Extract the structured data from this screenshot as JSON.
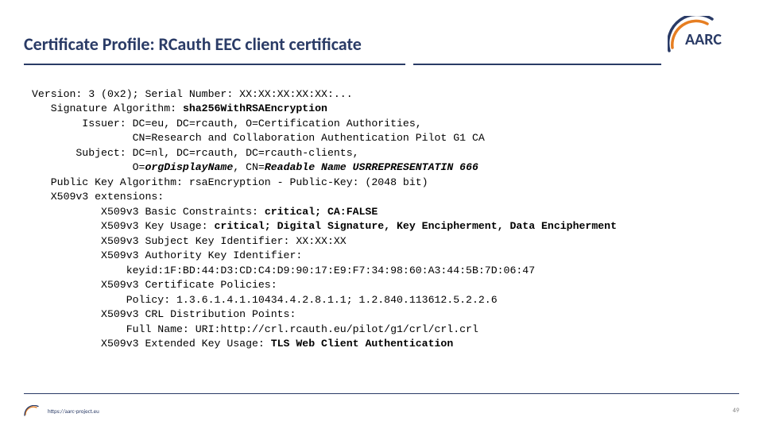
{
  "title": "Certificate Profile: RCauth EEC client certificate",
  "logo_text": "AARC",
  "footer_url": "https://aarc-project.eu",
  "page_number": "49",
  "cert": {
    "l01a": "Version: 3 (0x2); Serial Number: ",
    "l01b": "XX:XX:XX:XX:XX:...",
    "l02a": "   Signature Algorithm: ",
    "l02b": "sha256WithRSAEncryption",
    "l03": "        Issuer: DC=eu, DC=rcauth, O=Certification Authorities,",
    "l04": "                CN=Research and Collaboration Authentication Pilot G1 CA",
    "l05": "       Subject: DC=nl, DC=rcauth, DC=rcauth-clients,",
    "l06a": "                O=",
    "l06b": "orgDisplayName",
    "l06c": ", CN=",
    "l06d": "Readable Name USRREPRESENTATIN 666",
    "l07": "   Public Key Algorithm: rsaEncryption - Public-Key: (2048 bit)",
    "l08": "   X509v3 extensions:",
    "l09a": "           X509v3 Basic Constraints: ",
    "l09b": "critical; CA:FALSE",
    "l10a": "           X509v3 Key Usage: ",
    "l10b": "critical; Digital Signature, Key Encipherment, Data Encipherment",
    "l11a": "           X509v3 Subject Key Identifier: ",
    "l11b": "XX:XX:XX",
    "l12": "           X509v3 Authority Key Identifier:",
    "l13": "               keyid:1F:BD:44:D3:CD:C4:D9:90:17:E9:F7:34:98:60:A3:44:5B:7D:06:47",
    "l14": "           X509v3 Certificate Policies:",
    "l15": "               Policy: 1.3.6.1.4.1.10434.4.2.8.1.1; 1.2.840.113612.5.2.2.6",
    "l16": "           X509v3 CRL Distribution Points:",
    "l17": "               Full Name: URI:http://crl.rcauth.eu/pilot/g1/crl/crl.crl",
    "l18a": "           X509v3 Extended Key Usage: ",
    "l18b": "TLS Web Client Authentication"
  }
}
